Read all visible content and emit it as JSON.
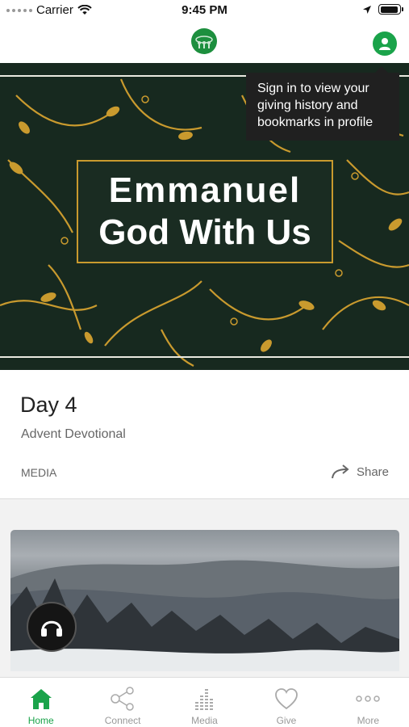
{
  "status_bar": {
    "carrier": "Carrier",
    "time": "9:45 PM",
    "battery_level": 0.95
  },
  "nav": {
    "logo_icon": "church-logo-icon",
    "profile_icon": "user-icon"
  },
  "tooltip": {
    "text": "Sign in to view your giving history and bookmarks in profile"
  },
  "hero": {
    "line1": "Emmanuel",
    "line2": "God With Us",
    "background_color": "#17291f",
    "accent_color": "#c99a2e"
  },
  "card": {
    "title": "Day 4",
    "subtitle": "Advent Devotional",
    "category": "MEDIA",
    "share_label": "Share"
  },
  "media": {
    "audio_icon": "headphones-icon"
  },
  "tabs": [
    {
      "label": "Home",
      "icon": "home-icon",
      "active": true
    },
    {
      "label": "Connect",
      "icon": "share-nodes-icon",
      "active": false
    },
    {
      "label": "Media",
      "icon": "equalizer-icon",
      "active": false
    },
    {
      "label": "Give",
      "icon": "heart-icon",
      "active": false
    },
    {
      "label": "More",
      "icon": "more-dots-icon",
      "active": false
    }
  ],
  "colors": {
    "brand_green": "#1aa34a",
    "inactive_gray": "#999999"
  }
}
